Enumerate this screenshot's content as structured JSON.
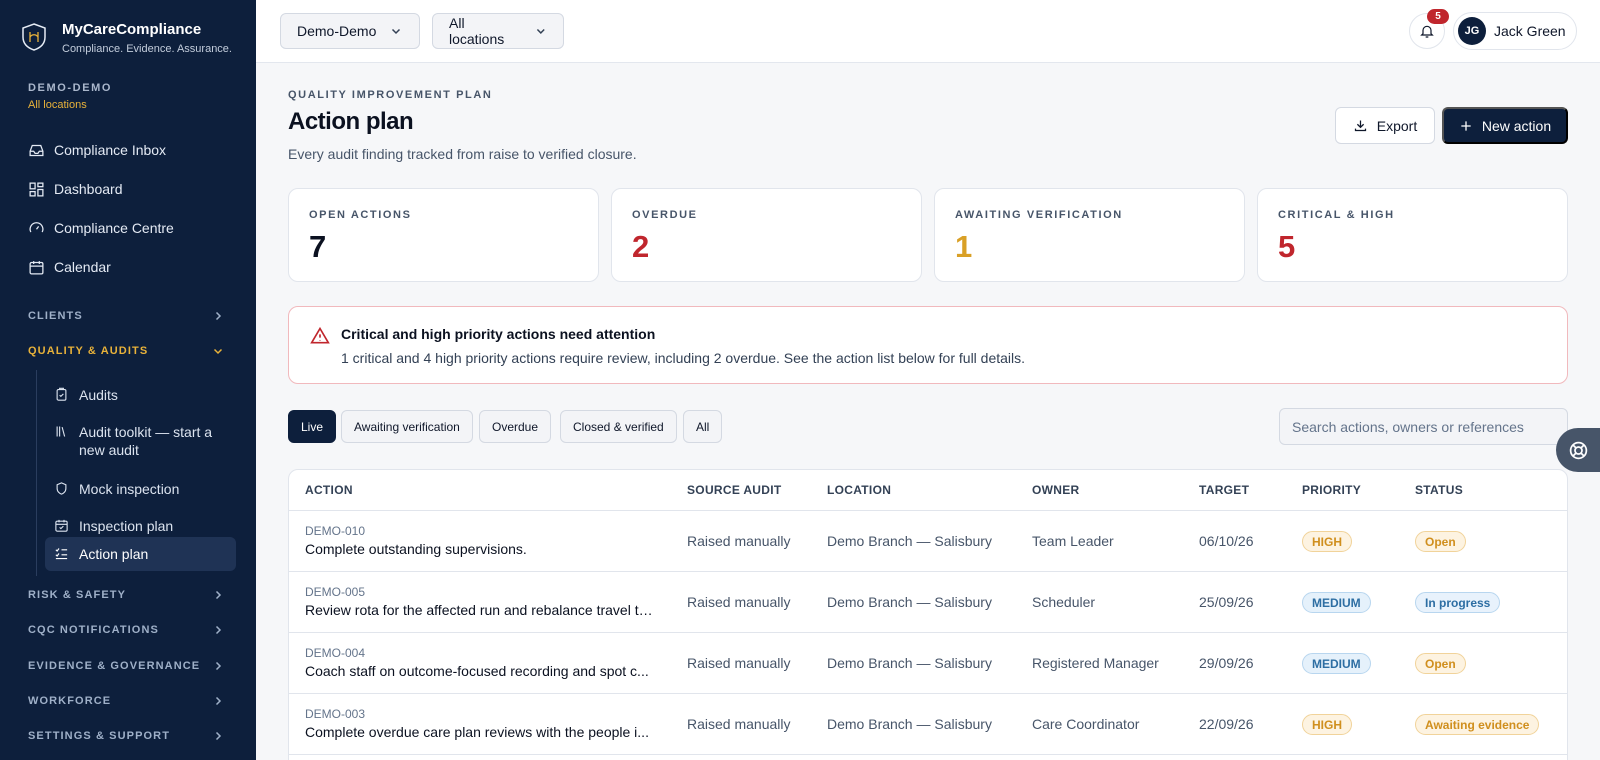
{
  "brand": {
    "name": "MyCareCompliance",
    "tagline": "Compliance. Evidence. Assurance."
  },
  "org": {
    "name": "DEMO-DEMO",
    "location": "All locations"
  },
  "nav": {
    "items": [
      {
        "label": "Compliance Inbox",
        "icon": "inbox-icon"
      },
      {
        "label": "Dashboard",
        "icon": "dashboard-icon"
      },
      {
        "label": "Compliance Centre",
        "icon": "gauge-icon"
      },
      {
        "label": "Calendar",
        "icon": "calendar-icon"
      }
    ],
    "sections": {
      "clients": "CLIENTS",
      "quality": "QUALITY & AUDITS",
      "risk": "RISK & SAFETY",
      "cqc": "CQC NOTIFICATIONS",
      "evidence": "EVIDENCE & GOVERNANCE",
      "workforce": "WORKFORCE",
      "settings": "SETTINGS & SUPPORT"
    },
    "sub_items": [
      {
        "label": "Audits",
        "icon": "clipboard-check-icon"
      },
      {
        "label": "Audit toolkit — start a new audit",
        "icon": "library-icon"
      },
      {
        "label": "Mock inspection",
        "icon": "shield-icon"
      },
      {
        "label": "Inspection plan",
        "icon": "calendar-check-icon"
      },
      {
        "label": "Action plan",
        "icon": "list-checks-icon"
      }
    ]
  },
  "topbar": {
    "org_select": "Demo-Demo",
    "location_select": "All locations",
    "notifications_count": "5",
    "user_initials": "JG",
    "user_name": "Jack Green"
  },
  "page": {
    "eyebrow": "QUALITY IMPROVEMENT PLAN",
    "title": "Action plan",
    "subtitle": "Every audit finding tracked from raise to verified closure.",
    "export_label": "Export",
    "new_label": "New action"
  },
  "stats": [
    {
      "label": "OPEN ACTIONS",
      "value": "7",
      "color": "#0b1120"
    },
    {
      "label": "OVERDUE",
      "value": "2",
      "color": "#c0262d"
    },
    {
      "label": "AWAITING VERIFICATION",
      "value": "1",
      "color": "#d9a026"
    },
    {
      "label": "CRITICAL & HIGH",
      "value": "5",
      "color": "#c0262d"
    }
  ],
  "alert": {
    "title": "Critical and high priority actions need attention",
    "body": "1 critical and 4 high priority actions require review, including 2 overdue. See the action list below for full details."
  },
  "filters": {
    "tabs": [
      "Live",
      "Awaiting verification",
      "Overdue",
      "Closed & verified",
      "All"
    ],
    "search_placeholder": "Search actions, owners or references"
  },
  "table": {
    "headers": [
      "ACTION",
      "SOURCE AUDIT",
      "LOCATION",
      "OWNER",
      "TARGET",
      "PRIORITY",
      "STATUS"
    ],
    "rows": [
      {
        "ref": "DEMO-010",
        "title": "Complete outstanding supervisions.",
        "source": "Raised manually",
        "location": "Demo Branch — Salisbury",
        "owner": "Team Leader",
        "target": "06/10/26",
        "priority": "HIGH",
        "status": "Open"
      },
      {
        "ref": "DEMO-005",
        "title": "Review rota for the affected run and rebalance travel ti...",
        "source": "Raised manually",
        "location": "Demo Branch — Salisbury",
        "owner": "Scheduler",
        "target": "25/09/26",
        "priority": "MEDIUM",
        "status": "In progress"
      },
      {
        "ref": "DEMO-004",
        "title": "Coach staff on outcome-focused recording and spot c...",
        "source": "Raised manually",
        "location": "Demo Branch — Salisbury",
        "owner": "Registered Manager",
        "target": "29/09/26",
        "priority": "MEDIUM",
        "status": "Open"
      },
      {
        "ref": "DEMO-003",
        "title": "Complete overdue care plan reviews with the people i...",
        "source": "Raised manually",
        "location": "Demo Branch — Salisbury",
        "owner": "Care Coordinator",
        "target": "22/09/26",
        "priority": "HIGH",
        "status": "Awaiting evidence"
      }
    ]
  }
}
